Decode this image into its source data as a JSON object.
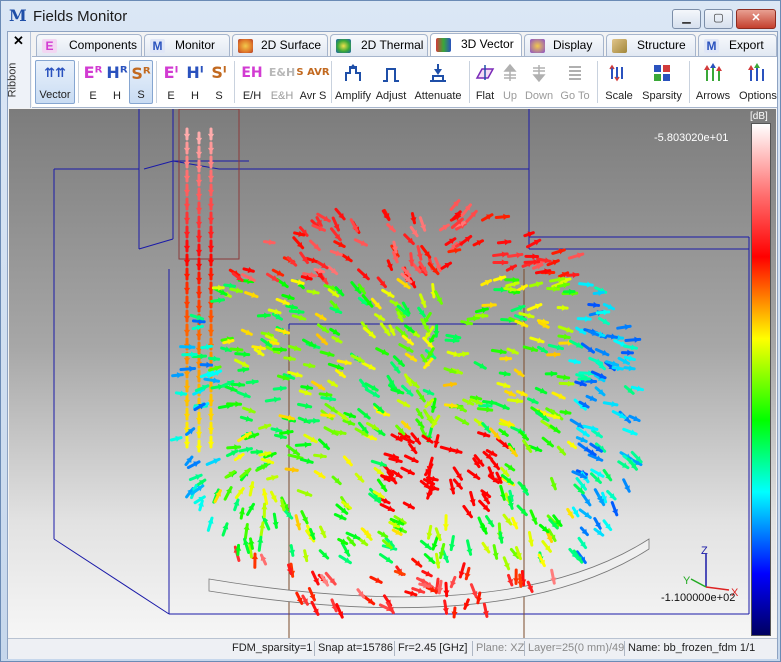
{
  "window": {
    "app_icon": "M",
    "title": "Fields Monitor",
    "min_glyph": "▁",
    "max_glyph": "▢",
    "close_glyph": "✕"
  },
  "ribbon": {
    "close_glyph": "✕",
    "label": "Ribbon"
  },
  "tabs": [
    {
      "label": "Components",
      "icon": "components-icon",
      "color": "#d23bd2"
    },
    {
      "label": "Monitor",
      "icon": "monitor-icon",
      "color": "#2a52be"
    },
    {
      "label": "2D Surface",
      "icon": "2d-surface-icon",
      "color": "#e07a2a"
    },
    {
      "label": "2D Thermal",
      "icon": "2d-thermal-icon",
      "color": "#3aa838"
    },
    {
      "label": "3D Vector",
      "icon": "3d-vector-icon",
      "color": "#d23b3b",
      "active": true
    },
    {
      "label": "Display",
      "icon": "display-icon",
      "color": "#8a4fc9"
    },
    {
      "label": "Structure",
      "icon": "structure-icon",
      "color": "#a2873a"
    },
    {
      "label": "Export",
      "icon": "export-icon",
      "color": "#2a52be"
    }
  ],
  "toolbar": {
    "vector": "Vector",
    "e": "E",
    "h": "H",
    "s": "S",
    "e2": "E",
    "h2": "H",
    "s2": "S",
    "eh": "E/H",
    "eh2": "E&H",
    "avrs": "Avr S",
    "amplify": "Amplify",
    "adjust": "Adjust",
    "attenuate": "Attenuate",
    "flat": "Flat",
    "up": "Up",
    "down": "Down",
    "goto": "Go To",
    "scale": "Scale",
    "sparsity": "Sparsity",
    "arrows": "Arrows",
    "options": "Options",
    "icon_vector": "⇈⇈",
    "icon_e": "Eᴿ",
    "icon_h": "Hᴿ",
    "icon_s": "Sᴿ",
    "icon_e2": "Eᴵ",
    "icon_h2": "Hᴵ",
    "icon_s2": "Sᴵ",
    "icon_eh": "EH",
    "icon_eh2": "E&H",
    "icon_avrs": "S AVR"
  },
  "view": {
    "colorbar_unit": "[dB]",
    "colorbar_max": "-5.803020e+01",
    "colorbar_min": "-1.100000e+02",
    "axis_z": "Z",
    "axis_y": "Y",
    "axis_x": "X"
  },
  "status": {
    "sparsity": "FDM_sparsity=1",
    "snap": "Snap at=15786",
    "freq": "Fr=2.45 [GHz]",
    "plane": "Plane: XZ",
    "layer": "Layer=25(0 mm)/49",
    "name": "Name: bb_frozen_fdm 1/1"
  }
}
